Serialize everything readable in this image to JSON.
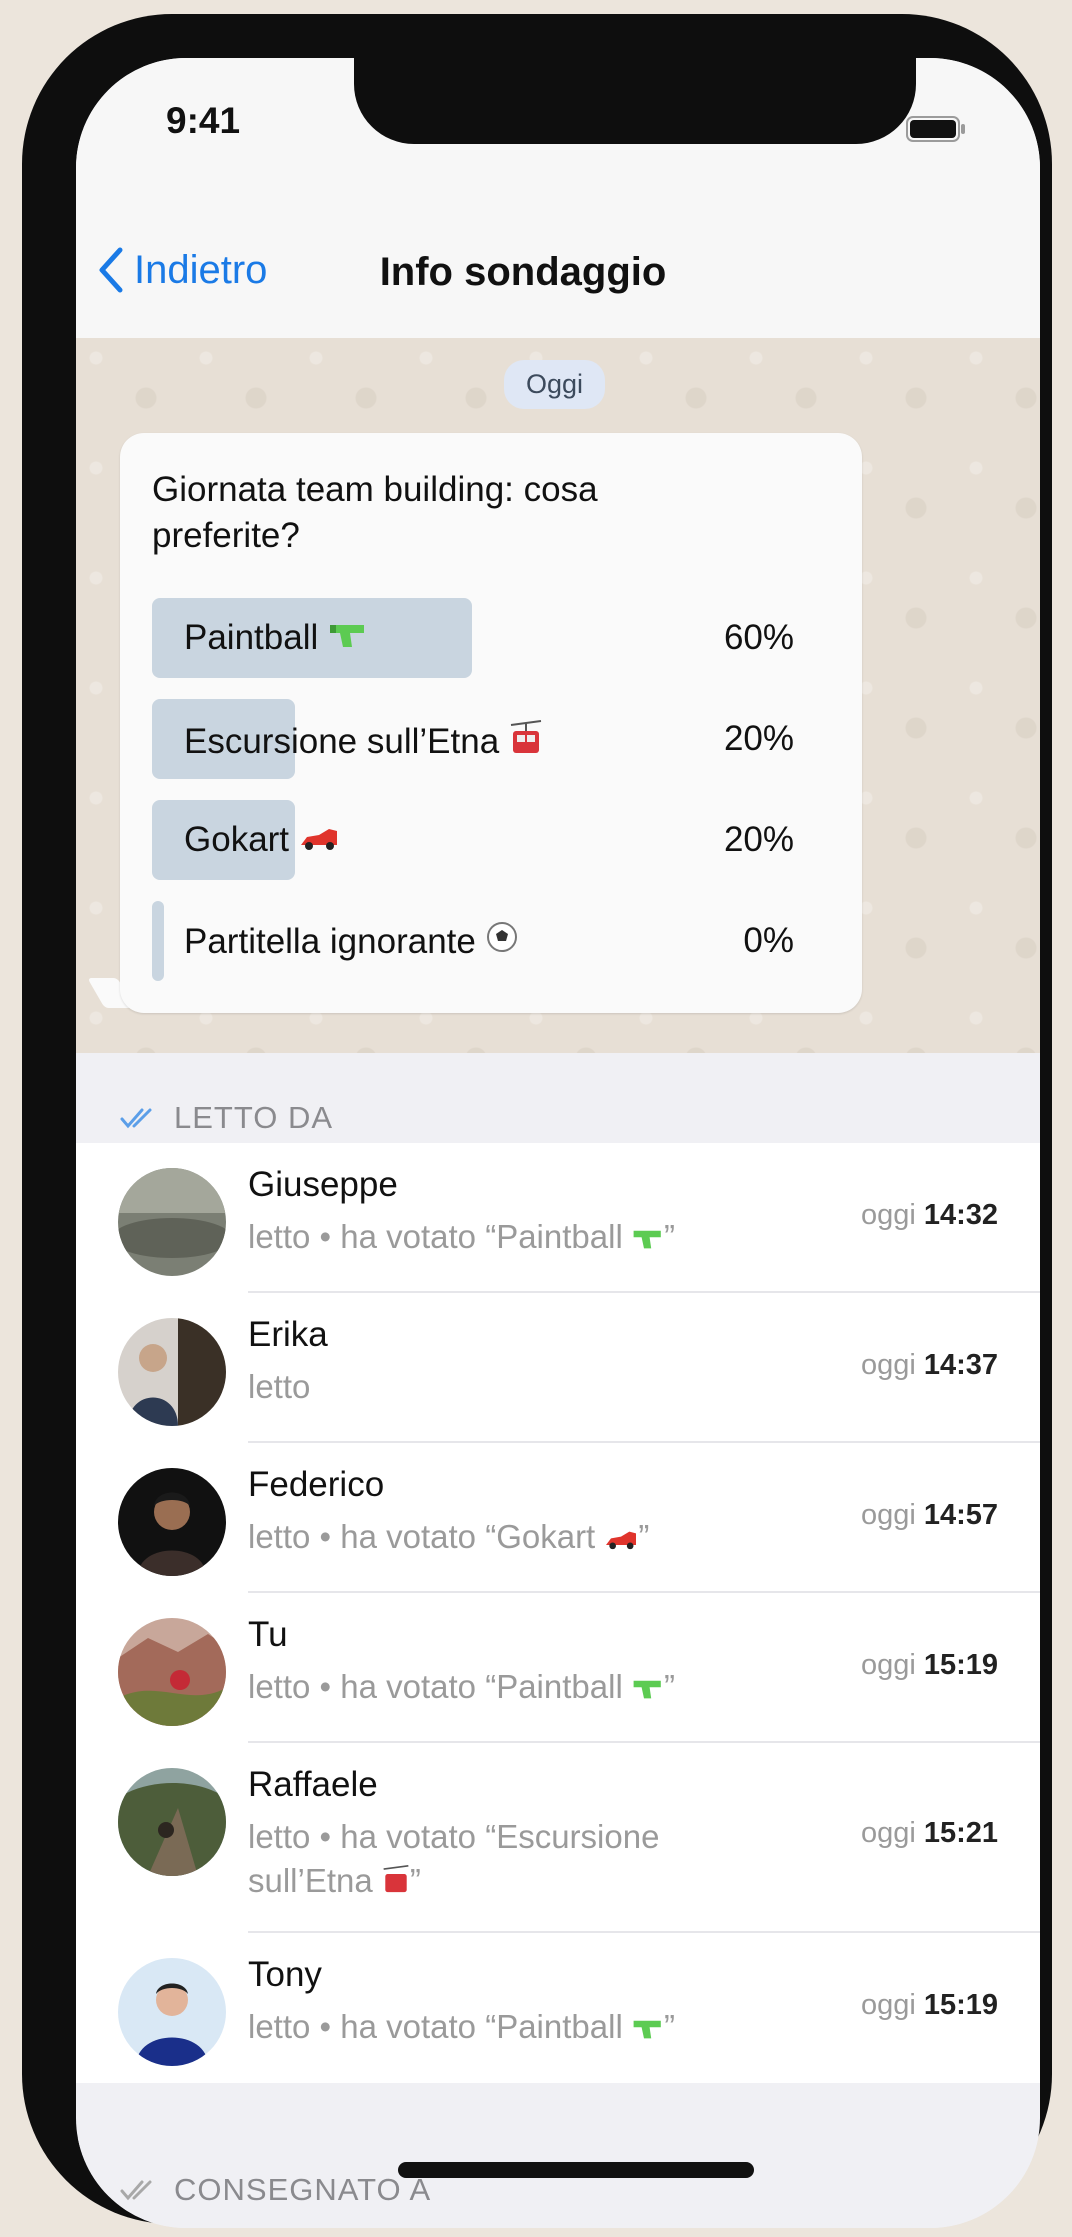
{
  "status": {
    "time": "9:41"
  },
  "nav": {
    "back_label": "Indietro",
    "title": "Info sondaggio"
  },
  "chat": {
    "date_pill": "Oggi",
    "poll": {
      "question": "Giornata team building: cosa preferite?",
      "options": [
        {
          "label": "Paintball",
          "icon": "water-pistol-icon",
          "percent": "60%",
          "fraction": 0.6
        },
        {
          "label": "Escursione sull’Etna",
          "icon": "cable-car-icon",
          "percent": "20%",
          "fraction": 0.2
        },
        {
          "label": "Gokart",
          "icon": "racing-car-icon",
          "percent": "20%",
          "fraction": 0.2
        },
        {
          "label": "Partitella ignorante",
          "icon": "soccer-ball-icon",
          "percent": "0%",
          "fraction": 0.0
        }
      ]
    }
  },
  "read_section": {
    "title": "LETTO DA",
    "rows": [
      {
        "name": "Giuseppe",
        "sub": "letto • ha votato “Paintball ",
        "sub_end": "”",
        "icon": "water-pistol-icon",
        "day": "oggi",
        "time": "14:32"
      },
      {
        "name": "Erika",
        "sub": "letto",
        "sub_end": "",
        "icon": "",
        "day": "oggi",
        "time": "14:37"
      },
      {
        "name": "Federico",
        "sub": "letto • ha votato “Gokart ",
        "sub_end": "”",
        "icon": "racing-car-icon",
        "day": "oggi",
        "time": "14:57"
      },
      {
        "name": "Tu",
        "sub": "letto • ha votato “Paintball ",
        "sub_end": "”",
        "icon": "water-pistol-icon",
        "day": "oggi",
        "time": "15:19"
      },
      {
        "name": "Raffaele",
        "sub": "letto • ha votato “Escursione sull’Etna ",
        "sub_end": "”",
        "icon": "cable-car-icon",
        "day": "oggi",
        "time": "15:21"
      },
      {
        "name": "Tony",
        "sub": "letto • ha votato “Paintball ",
        "sub_end": "”",
        "icon": "water-pistol-icon",
        "day": "oggi",
        "time": "15:19"
      }
    ]
  },
  "delivered_section": {
    "title": "CONSEGNATO A"
  },
  "colors": {
    "accent": "#1a7ae6",
    "bar": "#c9d5e0",
    "checkmark": "#5b9ee8",
    "muted": "#9a9a9a"
  }
}
